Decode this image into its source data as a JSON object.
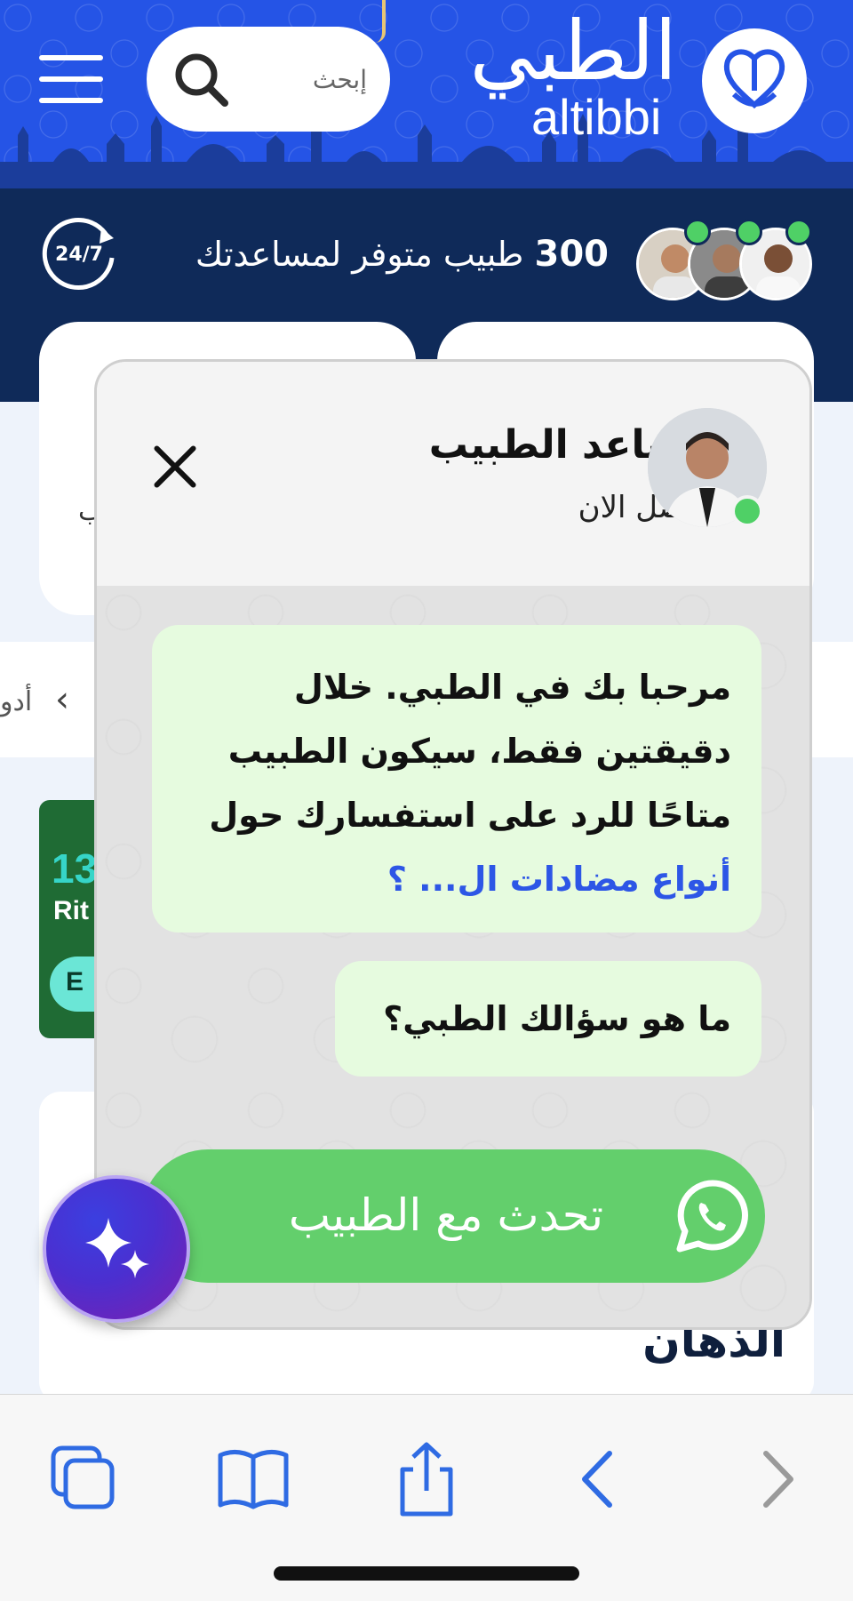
{
  "header": {
    "brand_ar": "الطبي",
    "brand_en": "altibbi",
    "search_placeholder": "إبحث",
    "menu_icon": "hamburger-menu-icon",
    "search_icon": "search-icon",
    "logo_icon": "altibbi-logo-icon"
  },
  "stats": {
    "doctor_count": "300",
    "doctor_text": "طبيب متوفر لمساعدتك",
    "availability_badge": "24/7"
  },
  "background": {
    "row_partial_text": "أدو",
    "promo_number": "13",
    "promo_sub": "Rit",
    "promo_button": "E",
    "card_partial_text": "ب",
    "lower_card_title": "الذهان"
  },
  "chat": {
    "agent_name": "مساعد الطبيب",
    "agent_status": "متصل الان",
    "message_1_text": "مرحبا بك في الطبي. خلال دقيقتين فقط، سيكون الطبيب متاحًا للرد على استفسارك حول",
    "message_1_link": "أنواع مضادات ال... ؟",
    "message_2_text": "ما هو سؤالك الطبي؟",
    "whatsapp_button_label": "تحدث مع الطبيب",
    "whatsapp_icon": "whatsapp-icon",
    "close_icon": "close-icon"
  },
  "colors": {
    "header_blue": "#2554e6",
    "stats_navy": "#0f2a59",
    "bubble_green": "#e6fbdf",
    "whatsapp_green": "#63cf6c",
    "link_blue": "#2d56e6",
    "online_green": "#4fd066"
  },
  "toolbar": {
    "items": [
      "tabs-icon",
      "bookmarks-icon",
      "share-icon",
      "back-icon",
      "forward-icon"
    ]
  }
}
